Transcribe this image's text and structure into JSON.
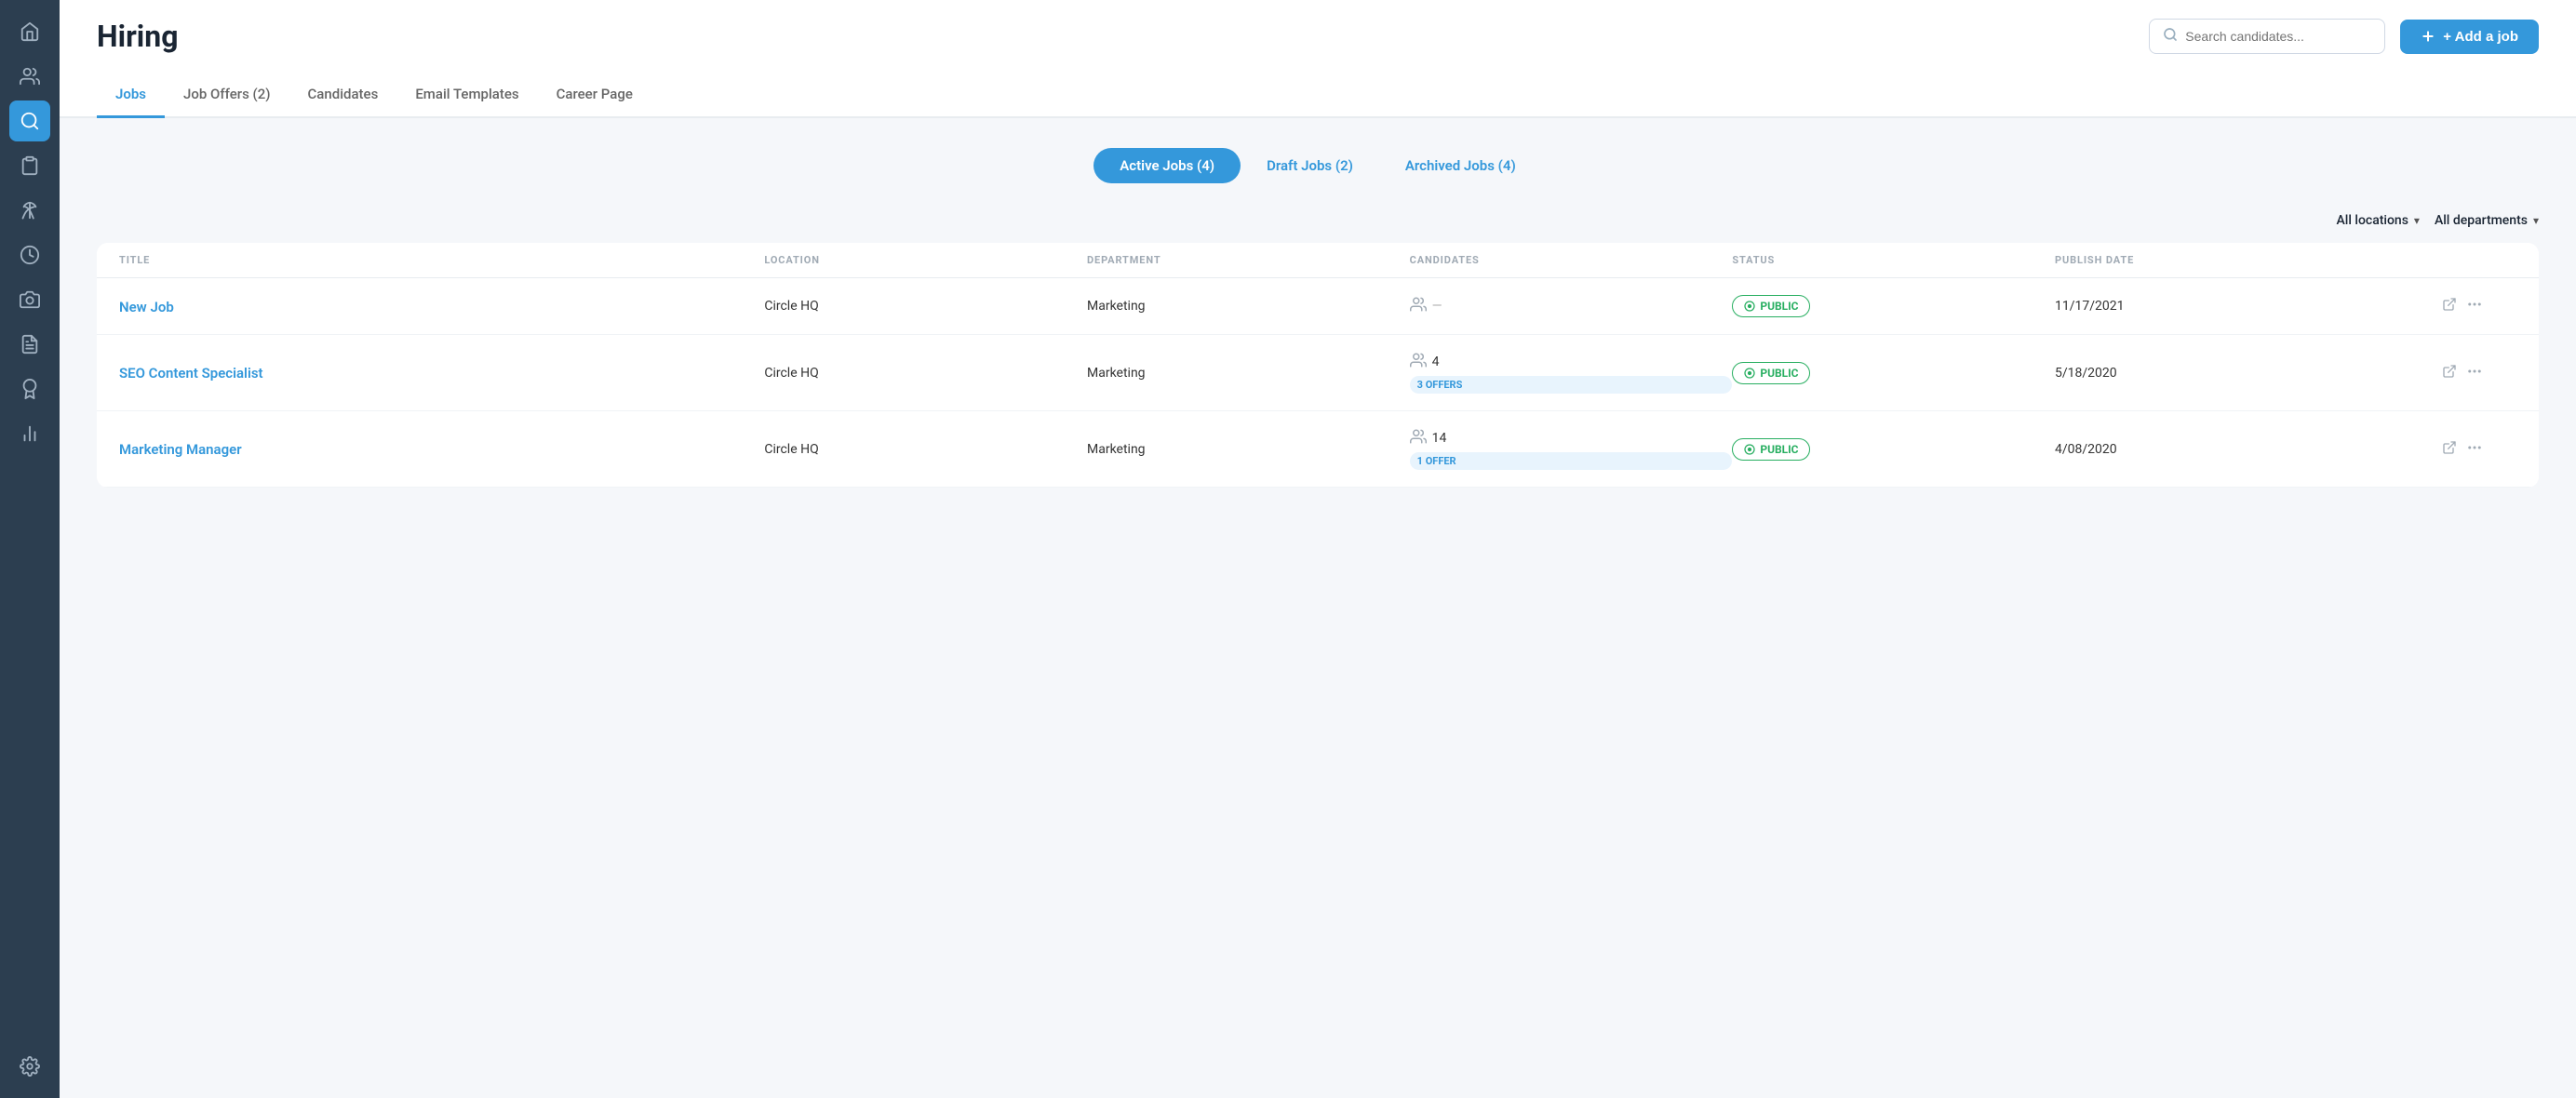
{
  "page": {
    "title": "Hiring"
  },
  "sidebar": {
    "icons": [
      {
        "name": "home-icon",
        "symbol": "⌂",
        "active": false
      },
      {
        "name": "users-icon",
        "symbol": "👤",
        "active": false
      },
      {
        "name": "search-people-icon",
        "symbol": "🔍",
        "active": true
      },
      {
        "name": "clipboard-icon",
        "symbol": "📋",
        "active": false
      },
      {
        "name": "vacation-icon",
        "symbol": "🌴",
        "active": false
      },
      {
        "name": "clock-icon",
        "symbol": "🕐",
        "active": false
      },
      {
        "name": "camera-icon",
        "symbol": "📷",
        "active": false
      },
      {
        "name": "document-icon",
        "symbol": "📄",
        "active": false
      },
      {
        "name": "award-icon",
        "symbol": "🏆",
        "active": false
      },
      {
        "name": "chart-icon",
        "symbol": "📊",
        "active": false
      },
      {
        "name": "settings-icon",
        "symbol": "⚙",
        "active": false
      }
    ]
  },
  "header": {
    "search_placeholder": "Search candidates...",
    "add_job_label": "+ Add a job"
  },
  "tabs": [
    {
      "id": "jobs",
      "label": "Jobs",
      "active": true
    },
    {
      "id": "job-offers",
      "label": "Job Offers (2)",
      "active": false
    },
    {
      "id": "candidates",
      "label": "Candidates",
      "active": false
    },
    {
      "id": "email-templates",
      "label": "Email Templates",
      "active": false
    },
    {
      "id": "career-page",
      "label": "Career Page",
      "active": false
    }
  ],
  "filter_tabs": [
    {
      "id": "active",
      "label": "Active Jobs (4)",
      "active": true
    },
    {
      "id": "draft",
      "label": "Draft Jobs (2)",
      "active": false
    },
    {
      "id": "archived",
      "label": "Archived Jobs (4)",
      "active": false
    }
  ],
  "filters": {
    "location_label": "All locations",
    "department_label": "All departments"
  },
  "table": {
    "columns": [
      {
        "id": "title",
        "label": "TITLE"
      },
      {
        "id": "location",
        "label": "LOCATION"
      },
      {
        "id": "department",
        "label": "DEPARTMENT"
      },
      {
        "id": "candidates",
        "label": "CANDIDATES"
      },
      {
        "id": "status",
        "label": "STATUS"
      },
      {
        "id": "publish_date",
        "label": "PUBLISH DATE"
      },
      {
        "id": "actions",
        "label": ""
      }
    ],
    "rows": [
      {
        "id": "row-1",
        "title": "New Job",
        "location": "Circle HQ",
        "department": "Marketing",
        "candidates_count": "—",
        "has_offers": false,
        "offers_label": "",
        "status": "PUBLIC",
        "publish_date": "11/17/2021"
      },
      {
        "id": "row-2",
        "title": "SEO Content Specialist",
        "location": "Circle HQ",
        "department": "Marketing",
        "candidates_count": "4",
        "has_offers": true,
        "offers_label": "3 OFFERS",
        "status": "PUBLIC",
        "publish_date": "5/18/2020"
      },
      {
        "id": "row-3",
        "title": "Marketing Manager",
        "location": "Circle HQ",
        "department": "Marketing",
        "candidates_count": "14",
        "has_offers": true,
        "offers_label": "1 OFFER",
        "status": "PUBLIC",
        "publish_date": "4/08/2020"
      }
    ]
  }
}
